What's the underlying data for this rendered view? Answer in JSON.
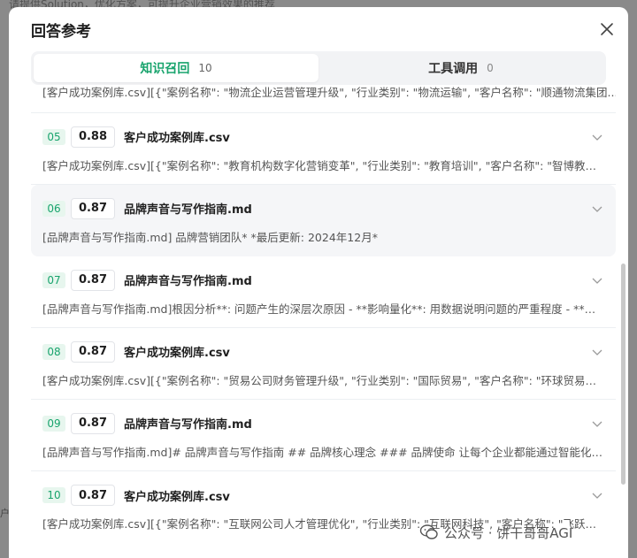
{
  "backdrop": {
    "top_text": "请提供Solution，优化方案，可提升企业营销效果的推荐",
    "side_text": "户"
  },
  "modal": {
    "title": "回答参考",
    "tabs": [
      {
        "label": "知识召回",
        "count": "10",
        "active": true
      },
      {
        "label": "工具调用",
        "count": "0",
        "active": false
      }
    ],
    "partial_row": "[客户成功案例库.csv][{\"案例名称\": \"物流企业运营管理升级\", \"行业类别\": \"物流运输\", \"客户名称\": \"顺通物流集团...",
    "items": [
      {
        "index": "05",
        "score": "0.88",
        "file": "客户成功案例库.csv",
        "snippet": "[客户成功案例库.csv][{\"案例名称\": \"教育机构数字化营销变革\", \"行业类别\": \"教育培训\", \"客户名称\": \"智博教育集团\"..."
      },
      {
        "index": "06",
        "score": "0.87",
        "file": "品牌声音与写作指南.md",
        "snippet": "[品牌声音与写作指南.md] 品牌营销团队* *最后更新: 2024年12月*"
      },
      {
        "index": "07",
        "score": "0.87",
        "file": "品牌声音与写作指南.md",
        "snippet": "[品牌声音与写作指南.md]根因分析**: 问题产生的深层次原因 - **影响量化**: 用数据说明问题的严重程度 - **趋势..."
      },
      {
        "index": "08",
        "score": "0.87",
        "file": "客户成功案例库.csv",
        "snippet": "[客户成功案例库.csv][{\"案例名称\": \"贸易公司财务管理升级\", \"行业类别\": \"国际贸易\", \"客户名称\": \"环球贸易有限公司\"..."
      },
      {
        "index": "09",
        "score": "0.87",
        "file": "品牌声音与写作指南.md",
        "snippet": "[品牌声音与写作指南.md]# 品牌声音与写作指南 ## 品牌核心理念 ### 品牌使命 让每个企业都能通过智能化CRM..."
      },
      {
        "index": "10",
        "score": "0.87",
        "file": "客户成功案例库.csv",
        "snippet": "[客户成功案例库.csv][{\"案例名称\": \"互联网公司人才管理优化\", \"行业类别\": \"互联网科技\", \"客户名称\": \"飞跃网络科技\"..."
      }
    ]
  },
  "watermark": {
    "text": "公众号 · 饼干哥哥AGI"
  },
  "colors": {
    "accent": "#19a46d",
    "index_bg": "#e7f6ee"
  }
}
